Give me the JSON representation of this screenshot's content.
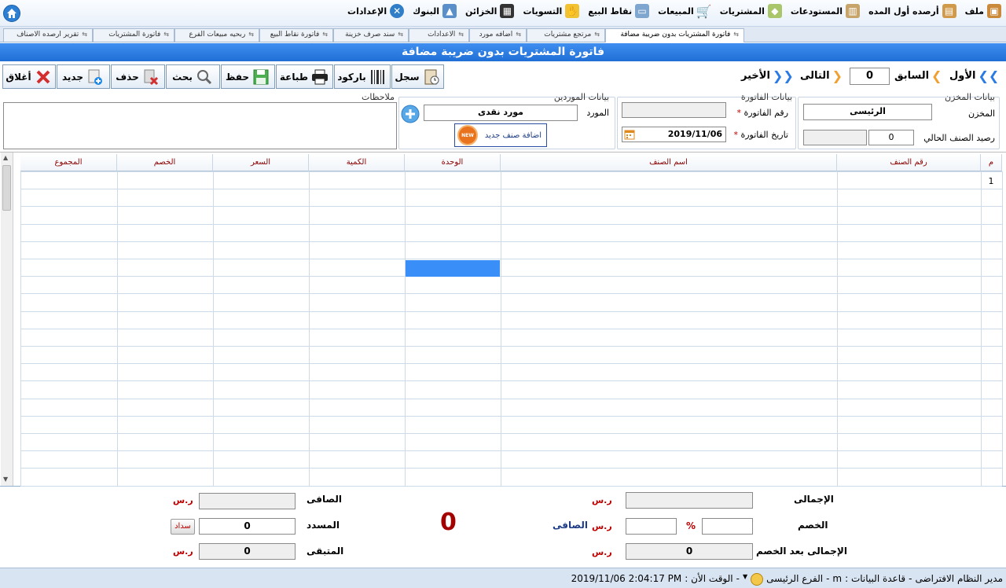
{
  "menubar": {
    "items": [
      {
        "label": "ملف",
        "icon": "file-box-icon"
      },
      {
        "label": "أرصده أول المده",
        "icon": "opening-balance-icon"
      },
      {
        "label": "المستودعات",
        "icon": "warehouse-icon"
      },
      {
        "label": "المشتريات",
        "icon": "purchases-icon"
      },
      {
        "label": "المبيعات",
        "icon": "sales-cart-icon"
      },
      {
        "label": "نقاط البيع",
        "icon": "pos-icon"
      },
      {
        "label": "التسويات",
        "icon": "settlements-icon"
      },
      {
        "label": "الخزائن",
        "icon": "safe-icon"
      },
      {
        "label": "البنوك",
        "icon": "bank-icon"
      },
      {
        "label": "الإعدادات",
        "icon": "settings-tools-icon"
      }
    ]
  },
  "tabs": [
    {
      "label": "فاتورة المشتريات بدون ضريبة مضافة",
      "active": true
    },
    {
      "label": "مرتجع مشتريات",
      "active": false
    },
    {
      "label": "اضافه مورد",
      "active": false
    },
    {
      "label": "الاعدادات",
      "active": false
    },
    {
      "label": "سند صرف خزينة",
      "active": false
    },
    {
      "label": "فاتورة نقاط البيع",
      "active": false
    },
    {
      "label": "ربحيه مبيعات الفرع",
      "active": false
    },
    {
      "label": "فاتورة المشتريات",
      "active": false
    },
    {
      "label": "تقرير ارصده الاصناف",
      "active": false
    }
  ],
  "title": "فاتورة المشتريات بدون ضريبة مضافة",
  "toolbar": {
    "log": "سجل",
    "barcode": "باركود",
    "print": "طباعة",
    "save": "حفظ",
    "search": "بحث",
    "delete": "حذف",
    "new": "جديد",
    "close": "أغلاق"
  },
  "nav": {
    "first": "الأول",
    "prev": "السابق",
    "record": "0",
    "next": "التالى",
    "last": "الأخير"
  },
  "warehouse_group": {
    "label": "بيانات المخزن",
    "warehouse_label": "المخزن",
    "warehouse_value": "الرئيسى",
    "balance_label": "رصيد الصنف الحالي",
    "balance_value": "0",
    "balance_extra": ""
  },
  "invoice_group": {
    "label": "بيانات الفاتورة",
    "number_label": "رقم الفاتورة",
    "number_value": "",
    "date_label": "تاريخ الفاتورة",
    "date_value": "2019/11/06",
    "required_mark": "*"
  },
  "supplier_group": {
    "label": "بيانات الموردين",
    "supplier_label": "المورد",
    "supplier_value": "مورد نقدى",
    "add_item_button": "اضافة صنف جديد",
    "new_badge": "NEW"
  },
  "notes": {
    "label": "ملاحظات",
    "value": ""
  },
  "grid": {
    "columns": [
      "م",
      "رقم الصنف",
      "اسم الصنف",
      "الوحدة",
      "الكمية",
      "السعر",
      "الخصم",
      "المجموع"
    ],
    "rows": [
      {
        "m": "1",
        "item_no": "",
        "item_name": "",
        "unit": "",
        "qty": "",
        "price": "",
        "discount": "",
        "total": ""
      }
    ]
  },
  "footer": {
    "total_label": "الإجمالى",
    "total_value": "",
    "discount_label": "الخصم",
    "discount_percent": "",
    "percent_sign": "%",
    "discount_amount": "",
    "after_discount_label": "الإجمالى بعد الخصم",
    "after_discount_value": "0",
    "currency": "ر.س",
    "net_label_mid": "الصافى",
    "big_net": "0",
    "net_label": "الصافى",
    "net_value": "",
    "paid_label": "المسدد",
    "paid_value": "0",
    "pay_button": "سداد",
    "remaining_label": "المتبقى",
    "remaining_value": "0"
  },
  "status": {
    "user": "مدير النظام الافتراضى",
    "sep1": "-",
    "db_label": "قاعدة البيانات :",
    "db_value": "m",
    "sep2": "-",
    "branch": "الفرع الرئيسى",
    "sep3": "-",
    "time_label": "الوقت الأن :",
    "time_value": "2019/11/06 2:04:17 PM"
  },
  "colors": {
    "title_bar": "#2a7be4",
    "header_text": "#8b0000",
    "selected_cell": "#3a8ef7",
    "currency_red": "#c00000"
  }
}
